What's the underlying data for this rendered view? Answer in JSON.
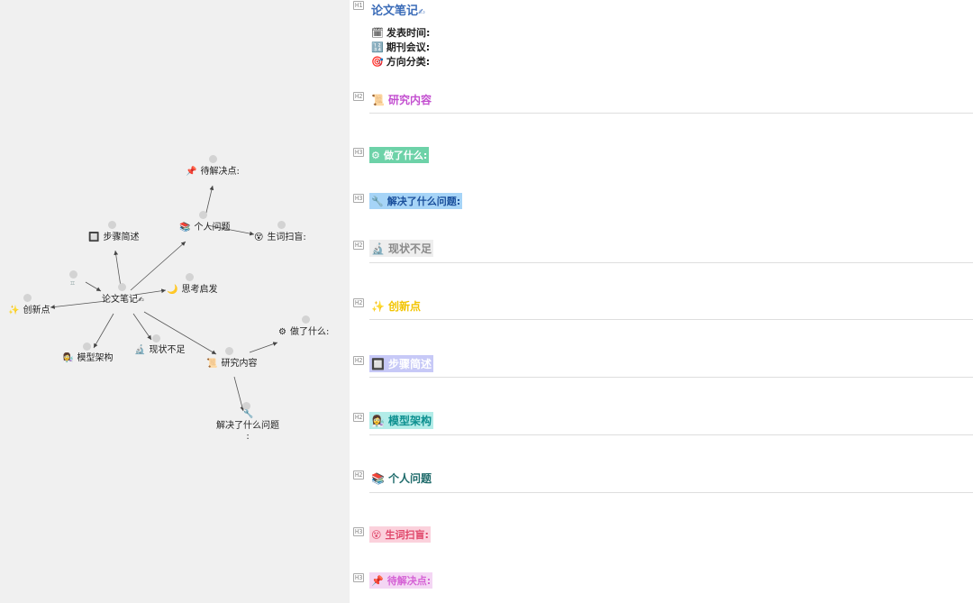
{
  "graph": {
    "nodes": {
      "root": {
        "label": "论文笔记",
        "icon": "✍"
      },
      "pending": {
        "label": "待解决点:",
        "icon": "📌"
      },
      "personal": {
        "label": "个人问题",
        "icon": "📚"
      },
      "vocab": {
        "label": "生词扫盲:",
        "icon": "😵"
      },
      "steps": {
        "label": "步骤简述",
        "icon": "🔲"
      },
      "thinking": {
        "label": "思考启发",
        "icon": "🌙"
      },
      "innov": {
        "label": "创新点",
        "icon": "✨"
      },
      "model": {
        "label": "模型架构",
        "icon": "👩‍🔬"
      },
      "status": {
        "label": "现状不足",
        "icon": "🔬"
      },
      "research": {
        "label": "研究内容",
        "icon": "📜"
      },
      "did": {
        "label": "做了什么:",
        "icon": "⚙"
      },
      "solved": {
        "label": "解决了什么问题",
        "sub": ":",
        "icon": "🔧"
      }
    }
  },
  "editor": {
    "title": {
      "tag": "H1",
      "text": "论文笔记",
      "icon": "✍"
    },
    "meta": [
      {
        "icon": "🗓",
        "text": "发表时间:"
      },
      {
        "icon": "🔢",
        "text": "期刊会议:"
      },
      {
        "icon": "🎯",
        "text": "方向分类:"
      }
    ],
    "headings": [
      {
        "tag": "H2",
        "text": "研究内容",
        "icon": "📜",
        "color": "#c34fd0",
        "bg": "transparent"
      },
      {
        "tag": "H3",
        "text": "做了什么:",
        "icon": "⚙",
        "color": "#ffffff",
        "bg": "#6dd2a8"
      },
      {
        "tag": "H3",
        "text": "解决了什么问题:",
        "icon": "🔧",
        "color": "#1a4f9c",
        "bg": "#a6d4f7"
      },
      {
        "tag": "H2",
        "text": "现状不足",
        "icon": "🔬",
        "color": "#8a8a8a",
        "bg": "#eeeeee"
      },
      {
        "tag": "H2",
        "text": "创新点",
        "icon": "✨",
        "color": "#f2c400",
        "bg": "transparent"
      },
      {
        "tag": "H2",
        "text": "步骤简述",
        "icon": "🔲",
        "color": "#ffffff",
        "bg": "#c7c9f7"
      },
      {
        "tag": "H2",
        "text": "模型架构",
        "icon": "👩‍🔬",
        "color": "#0c8f8f",
        "bg": "#b2ece8"
      },
      {
        "tag": "H2",
        "text": "个人问题",
        "icon": "📚",
        "color": "#1f6b6b",
        "bg": "transparent"
      },
      {
        "tag": "H3",
        "text": "生词扫盲:",
        "icon": "😵",
        "color": "#e0476a",
        "bg": "#fbd1dc"
      },
      {
        "tag": "H3",
        "text": "待解决点:",
        "icon": "📌",
        "color": "#d562d5",
        "bg": "#f4d6f4"
      }
    ]
  }
}
